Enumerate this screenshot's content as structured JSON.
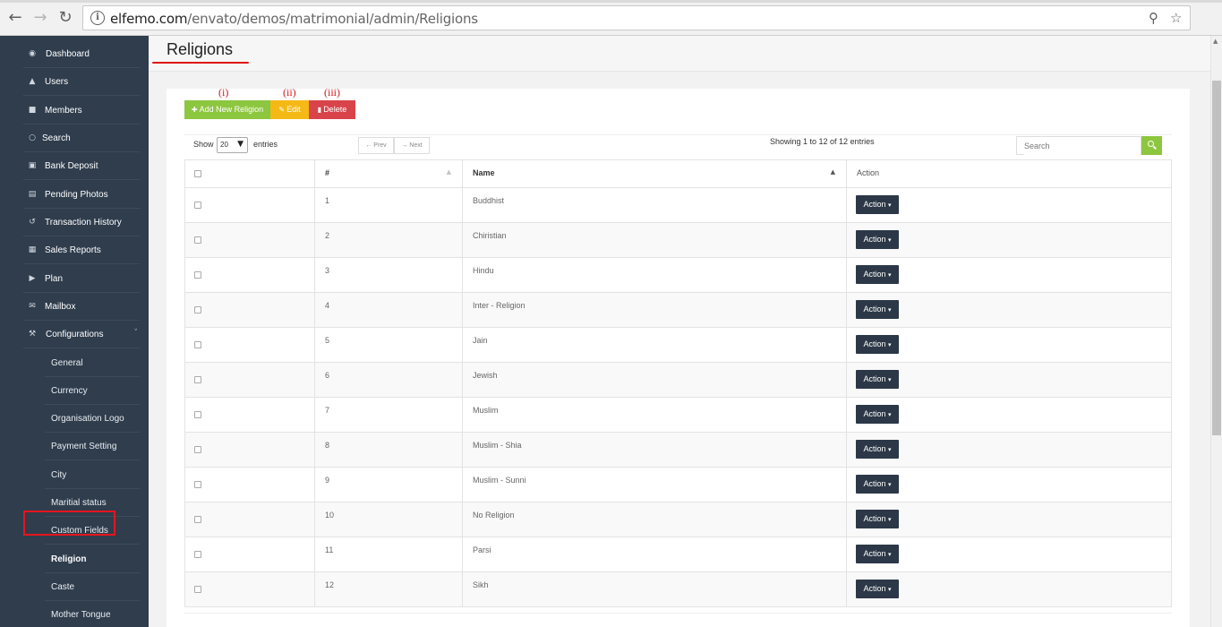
{
  "browser": {
    "url_host": "elfemo.com",
    "url_path": "/envato/demos/matrimonial/admin/Religions",
    "back_icon": "arrow-left-icon",
    "forward_icon": "arrow-right-icon",
    "reload_icon": "reload-icon"
  },
  "sidebar": {
    "items": [
      {
        "label": "Dashboard",
        "icon": "◉"
      },
      {
        "label": "Users",
        "icon": "▲"
      },
      {
        "label": "Members",
        "icon": "■"
      },
      {
        "label": "Search",
        "icon": "○"
      },
      {
        "label": "Bank Deposit",
        "icon": "▣"
      },
      {
        "label": "Pending Photos",
        "icon": "▤"
      },
      {
        "label": "Transaction History",
        "icon": "↺"
      },
      {
        "label": "Sales Reports",
        "icon": "▦"
      },
      {
        "label": "Plan",
        "icon": "▶"
      },
      {
        "label": "Mailbox",
        "icon": "✉"
      },
      {
        "label": "Configurations",
        "icon": "⚒",
        "chevron": "˅"
      }
    ],
    "subitems": [
      {
        "label": "General"
      },
      {
        "label": "Currency"
      },
      {
        "label": "Organisation Logo"
      },
      {
        "label": "Payment Setting"
      },
      {
        "label": "City"
      },
      {
        "label": "Maritial status"
      },
      {
        "label": "Custom Fields"
      },
      {
        "label": "Religion"
      },
      {
        "label": "Caste"
      },
      {
        "label": "Mother Tongue"
      }
    ]
  },
  "page": {
    "title": "Religions"
  },
  "annotations": {
    "add": "(i)",
    "edit": "(ii)",
    "delete": "(iii)"
  },
  "toolbar": {
    "add_label": "Add New Religion",
    "edit_label": "Edit",
    "delete_label": "Delete",
    "colors": {
      "add": "#8dc63f",
      "edit": "#f5b916",
      "delete": "#d9434a"
    }
  },
  "table_controls": {
    "show_label": "Show",
    "page_length": "20",
    "entries_label": "entries",
    "prev_label": "← Prev",
    "next_label": "→ Next",
    "info": "Showing 1 to 12 of 12 entries",
    "search_placeholder": "Search"
  },
  "table": {
    "headers": {
      "num": "#",
      "name": "Name",
      "action": "Action"
    },
    "action_label": "Action",
    "rows": [
      {
        "num": "1",
        "name": "Buddhist"
      },
      {
        "num": "2",
        "name": "Chiristian"
      },
      {
        "num": "3",
        "name": "Hindu"
      },
      {
        "num": "4",
        "name": "Inter - Religion"
      },
      {
        "num": "5",
        "name": "Jain"
      },
      {
        "num": "6",
        "name": "Jewish"
      },
      {
        "num": "7",
        "name": "Muslim"
      },
      {
        "num": "8",
        "name": "Muslim - Shia"
      },
      {
        "num": "9",
        "name": "Muslim - Sunni"
      },
      {
        "num": "10",
        "name": "No Religion"
      },
      {
        "num": "11",
        "name": "Parsi"
      },
      {
        "num": "12",
        "name": "Sikh"
      }
    ]
  }
}
